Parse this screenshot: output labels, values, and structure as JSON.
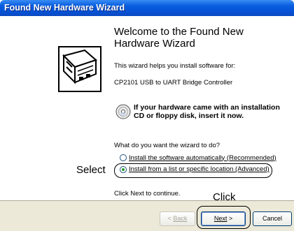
{
  "window": {
    "title": "Found New Hardware Wizard"
  },
  "main": {
    "heading": "Welcome to the Found New Hardware Wizard",
    "intro_text": "This wizard helps you install software for:",
    "device_name": "CP2101 USB to UART Bridge Controller",
    "cd_prompt": "If your hardware came with an installation CD or floppy disk, insert it now.",
    "question": "What do you want the wizard to do?",
    "options": [
      {
        "label": "Install the software automatically (Recommended)",
        "selected": false
      },
      {
        "label": "Install from a list or specific location (Advanced)",
        "selected": true
      }
    ],
    "continue_text": "Click Next to continue."
  },
  "annotations": {
    "select_label": "Select",
    "click_label": "Click"
  },
  "buttons": {
    "back_label": "Back",
    "next_label": "Next",
    "cancel_label": "Cancel"
  },
  "icons": {
    "wizard_logo": "hardware-card-icon",
    "cd_icon": "cd-disk-icon"
  }
}
